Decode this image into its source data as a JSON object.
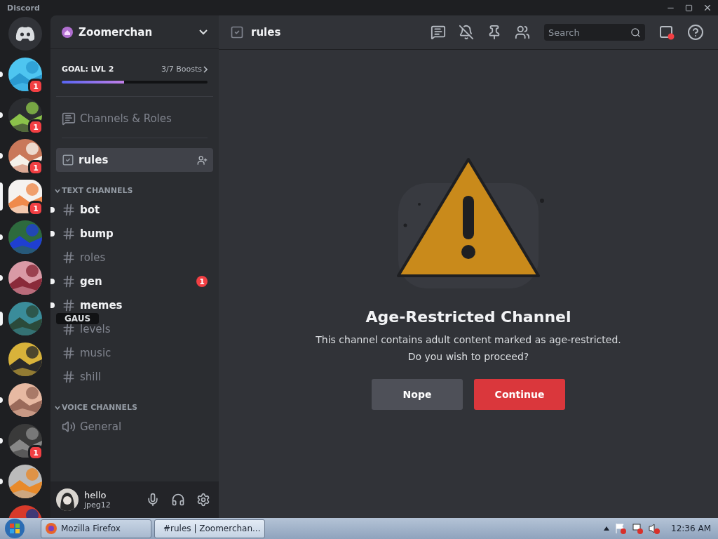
{
  "app_title": "Discord",
  "servers": [
    {
      "unread": true,
      "selected": false,
      "hovered": false,
      "badge": "1"
    },
    {
      "unread": true,
      "selected": false,
      "hovered": false,
      "badge": "1"
    },
    {
      "unread": true,
      "selected": false,
      "hovered": false,
      "badge": "1"
    },
    {
      "unread": false,
      "selected": true,
      "hovered": false,
      "badge": "1"
    },
    {
      "unread": true,
      "selected": false,
      "hovered": false
    },
    {
      "unread": true,
      "selected": false,
      "hovered": false
    },
    {
      "unread": false,
      "selected": false,
      "hovered": true
    },
    {
      "unread": false,
      "selected": false,
      "hovered": false
    },
    {
      "unread": true,
      "selected": false,
      "hovered": false
    },
    {
      "unread": true,
      "selected": false,
      "hovered": false,
      "badge": "1"
    },
    {
      "unread": true,
      "selected": false,
      "hovered": false
    },
    {
      "unread": false,
      "selected": false,
      "hovered": false
    }
  ],
  "tooltip": "GAUS",
  "server": {
    "name": "Zoomerchan",
    "goal": "GOAL: LVL 2",
    "boosts": "3/7 Boosts",
    "level": 0.43
  },
  "channels_roles": "Channels & Roles",
  "pinned_channel": {
    "name": "rules",
    "selected": true
  },
  "categories": [
    {
      "name": "TEXT CHANNELS",
      "expanded": true,
      "channels": [
        {
          "kind": "text",
          "name": "bot",
          "unread": true
        },
        {
          "kind": "text",
          "name": "bump",
          "unread": true
        },
        {
          "kind": "text",
          "name": "roles",
          "unread": false
        },
        {
          "kind": "text",
          "name": "gen",
          "unread": true,
          "badge": "1"
        },
        {
          "kind": "text",
          "name": "memes",
          "unread": true
        },
        {
          "kind": "text",
          "name": "levels",
          "unread": false
        },
        {
          "kind": "text",
          "name": "music",
          "unread": false
        },
        {
          "kind": "text",
          "name": "shill",
          "unread": false
        }
      ]
    },
    {
      "name": "VOICE CHANNELS",
      "expanded": true,
      "channels": [
        {
          "kind": "voice",
          "name": "General",
          "unread": false
        }
      ]
    }
  ],
  "user": {
    "name": "hello",
    "tag": "jpeg12"
  },
  "topbar": {
    "channel": "rules",
    "search": {
      "placeholder": "Search"
    }
  },
  "notice": {
    "title": "Age-Restricted Channel",
    "lines": [
      "This channel contains adult content marked as age-restricted.",
      "Do you wish to proceed?"
    ],
    "buttons": [
      {
        "kind": "secondary",
        "label": "Nope"
      },
      {
        "kind": "danger",
        "label": "Continue"
      }
    ]
  },
  "taskbar": {
    "items": [
      {
        "kind": "firefox",
        "label": "Mozilla Firefox",
        "selected": false
      },
      {
        "kind": "discord",
        "label": "#rules | Zoomerchan...",
        "selected": true
      }
    ],
    "clock": "12:36 AM"
  }
}
